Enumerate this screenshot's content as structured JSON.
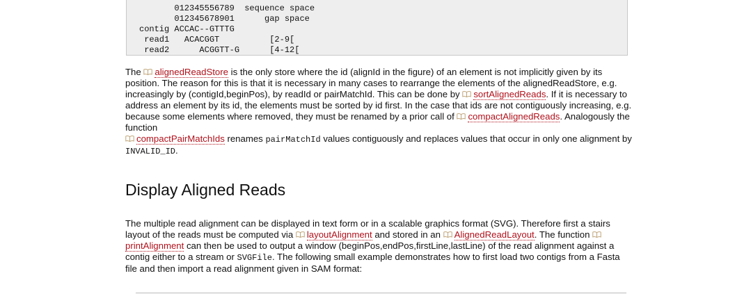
{
  "code_block": {
    "lines": [
      "       012345556789  sequence space",
      "       012345678901      gap space",
      "contig ACCAC--GTTTG",
      " read1   ACACGGT          [2-9[",
      " read2      ACGGTT-G      [4-12["
    ]
  },
  "para1": {
    "t1": "The ",
    "l1": "alignedReadStore",
    "t2": " is the only store where the id (alignId in the figure) of an element is not implicitly given by its position. The reason for this is that it is necessary in many cases to rearrange the elements of the alignedReadStore, e.g. increasingly by (contigId,beginPos), by readId or pairMatchId. This can be done by ",
    "l2": "sortAlignedReads",
    "t3": ". If it is necessary to address an element by its id, the elements must be sorted by id first. In the case that ids are not contiguously increasing, e.g. because some elements where removed, they must be renamed by a prior call of ",
    "l3": "compactAlignedReads",
    "t4": ". Analogously the function ",
    "l4": "compactPairMatchIds",
    "t5": " renames ",
    "c1": "pairMatchId",
    "t6": " values contiguously and replaces values that occur in only one alignment by ",
    "c2": "INVALID_ID",
    "t7": "."
  },
  "heading": "Display Aligned Reads",
  "para2": {
    "t1": "The multiple read alignment can be displayed in text form or in a scalable graphics format (SVG). Therefore first a stairs layout of the reads must be computed via ",
    "l1": "layoutAlignment",
    "t2": " and stored in an ",
    "l2": "AlignedReadLayout",
    "t3": ". The function ",
    "l3": "printAlignment",
    "t4": " can then be used to output a window (beginPos,endPos,firstLine,lastLine) of the read alignment against a contig either to a stream or ",
    "c1": "SVGFile",
    "t5": ". The following small example demonstrates how to first load two contigs from a Fasta file and then import a read alignment given in SAM format:"
  },
  "icons": {
    "link_icon": "book-icon"
  },
  "colors": {
    "link": "#b0121c",
    "code_bg": "#eeeeee"
  }
}
